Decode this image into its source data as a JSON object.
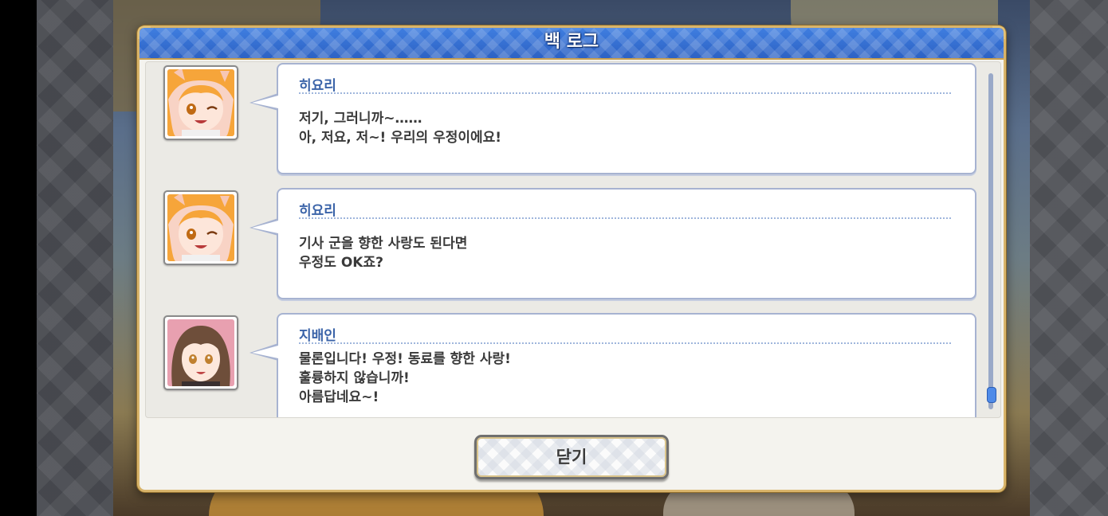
{
  "dialog": {
    "title": "백 로그",
    "close_label": "닫기"
  },
  "log": [
    {
      "speaker": "히요리",
      "avatar_icon": "hiyori-portrait-icon",
      "lines": [
        "저기, 그러니까~……",
        "아, 저요, 저~! 우리의 우정이에요!"
      ]
    },
    {
      "speaker": "히요리",
      "avatar_icon": "hiyori-portrait-icon",
      "lines": [
        "기사 군을 향한 사랑도 된다면",
        "우정도 OK죠?"
      ]
    },
    {
      "speaker": "지배인",
      "avatar_icon": "manager-portrait-icon",
      "lines": [
        "물론입니다! 우정! 동료를 향한 사랑!",
        "훌륭하지 않습니까!",
        "아름답네요~!"
      ]
    }
  ],
  "colors": {
    "header_blue": "#3f7ee0",
    "speaker_text": "#3a63a8",
    "frame_gold": "#d8b46a",
    "scroll_thumb": "#4f8be8"
  }
}
